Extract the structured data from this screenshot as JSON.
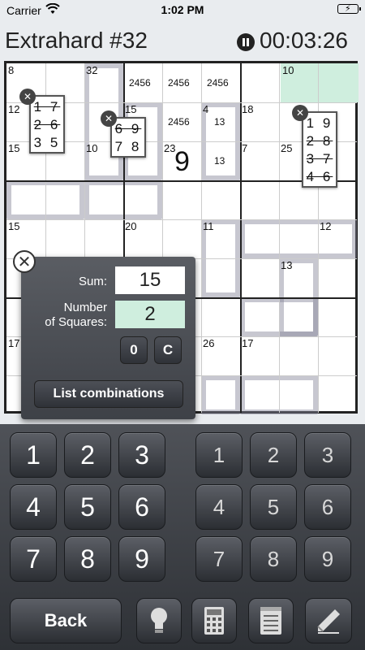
{
  "status_bar": {
    "carrier": "Carrier",
    "time": "1:02 PM"
  },
  "header": {
    "title": "Extrahard #32",
    "timer": "00:03:26"
  },
  "board": {
    "cage_labels": [
      "8",
      "32",
      "10",
      "12",
      "15",
      "4",
      "18",
      "15",
      "10",
      "23",
      "7",
      "25",
      "15",
      "20",
      "11",
      "12",
      "13",
      "17",
      "26",
      "17"
    ],
    "candidates": [
      "2456",
      "2456",
      "2456",
      "2456",
      "13",
      "13"
    ],
    "placed_value": "9",
    "notes": [
      {
        "rows": [
          "1 7",
          "2 6",
          "3 5"
        ],
        "struck": [
          true,
          true,
          false
        ]
      },
      {
        "rows": [
          "6 9",
          "7 8"
        ],
        "struck": [
          true,
          false
        ]
      },
      {
        "rows": [
          "1 9",
          "2 8",
          "3 7",
          "4 6"
        ],
        "struck": [
          false,
          true,
          true,
          true
        ]
      }
    ],
    "colors": {
      "highlight": "#cfeede"
    }
  },
  "calculator": {
    "sum_label": "Sum:",
    "sum_value": "15",
    "count_label": "Number\nof Squares:",
    "count_value": "2",
    "zero_button": "0",
    "clear_button": "C",
    "list_button": "List combinations"
  },
  "keypad": {
    "digits": [
      "1",
      "2",
      "3",
      "4",
      "5",
      "6",
      "7",
      "8",
      "9"
    ],
    "pencil_digits": [
      "1",
      "2",
      "3",
      "4",
      "5",
      "6",
      "7",
      "8",
      "9"
    ]
  },
  "toolbar": {
    "back_label": "Back",
    "icons": [
      "hint-bulb-icon",
      "calculator-icon",
      "notepad-icon",
      "eraser-icon"
    ]
  }
}
